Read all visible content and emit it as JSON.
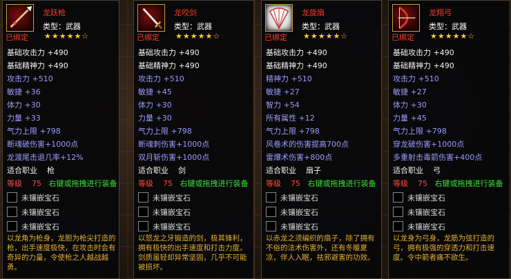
{
  "tooltips": [
    {
      "name": "龙跃枪",
      "type_label": "类型：武器",
      "bound": "已绑定",
      "stars": "★★★★★☆",
      "stats": [
        {
          "text": "基础攻击力 +490",
          "color": "white"
        },
        {
          "text": "基础精神力 +490",
          "color": "white"
        },
        {
          "text": "攻击力 +510",
          "color": "blue"
        },
        {
          "text": "敏捷 +36",
          "color": "blue"
        },
        {
          "text": "体力 +30",
          "color": "blue"
        },
        {
          "text": "力量 +33",
          "color": "blue"
        },
        {
          "text": "气力上限 +798",
          "color": "blue"
        },
        {
          "text": "断魂破伤害+1000点",
          "color": "blue"
        },
        {
          "text": "龙渡尾击退几率+12%",
          "color": "blue"
        }
      ],
      "job_label": "适合职业",
      "job_value": "枪",
      "level_label": "等级",
      "level_value": "75",
      "hint": "右键或拖拽进行装备",
      "sockets": [
        "未镶嵌宝石",
        "未镶嵌宝石",
        "未镶嵌宝石"
      ],
      "description": "以龙角为枪身，龙胆为枪尖打造的枪，出手速度极快，在攻击时会有奇异的力量，令使枪之人越战越勇。"
    },
    {
      "name": "龙咬剑",
      "type_label": "类型：武器",
      "bound": "已绑定",
      "stars": "★★★★★☆",
      "stats": [
        {
          "text": "基础攻击力 +490",
          "color": "white"
        },
        {
          "text": "基础精神力 +490",
          "color": "white"
        },
        {
          "text": "攻击力 +510",
          "color": "blue"
        },
        {
          "text": "敏捷 +45",
          "color": "blue"
        },
        {
          "text": "体力 +30",
          "color": "blue"
        },
        {
          "text": "力量 +30",
          "color": "blue"
        },
        {
          "text": "气力上限 +798",
          "color": "blue"
        },
        {
          "text": "断魂刺伤害+1000点",
          "color": "blue"
        },
        {
          "text": "双月斩伤害+1000点",
          "color": "blue"
        }
      ],
      "job_label": "适合职业",
      "job_value": "剑",
      "level_label": "等级",
      "level_value": "75",
      "hint": "右键或拖拽进行装备",
      "sockets": [
        "未镶嵌宝石",
        "未镶嵌宝石",
        "未镶嵌宝石"
      ],
      "description": "以怒龙之牙锻造的剑，极其锋利，拥有极快的出手速度和打击力度。剑质虽轻却异常坚固，几乎不可能被损坏。"
    },
    {
      "name": "龙旋扇",
      "type_label": "类型：武器",
      "bound": "已绑定",
      "stars": "★★★★★☆",
      "stats": [
        {
          "text": "基础攻击力 +490",
          "color": "white"
        },
        {
          "text": "基础精神力 +490",
          "color": "white"
        },
        {
          "text": "精神力 +510",
          "color": "blue"
        },
        {
          "text": "敏捷 +27",
          "color": "blue"
        },
        {
          "text": "智力 +54",
          "color": "blue"
        },
        {
          "text": "所有属性 +12",
          "color": "blue"
        },
        {
          "text": "气力上限 +798",
          "color": "blue"
        },
        {
          "text": "风卷术的伤害提高700点",
          "color": "blue"
        },
        {
          "text": "雷爆术伤害+800点",
          "color": "blue"
        }
      ],
      "job_label": "适合职业",
      "job_value": "扇子",
      "level_label": "等级",
      "level_value": "75",
      "hint": "右键或拖拽进行装备",
      "sockets": [
        "未镶嵌宝石",
        "未镶嵌宝石",
        "未镶嵌宝石"
      ],
      "description": "以赤龙之须编织的扇子，除了拥有不俗的法术伤害外，还有冬暖夏凉，伴人入眠，祛邪避害的功效。"
    },
    {
      "name": "龙翔弓",
      "type_label": "类型：武器",
      "bound": "已绑定",
      "stars": "★★★★★☆",
      "stats": [
        {
          "text": "基础攻击力 +490",
          "color": "white"
        },
        {
          "text": "基础精神力 +490",
          "color": "white"
        },
        {
          "text": "攻击力 +510",
          "color": "blue"
        },
        {
          "text": "敏捷 +27",
          "color": "blue"
        },
        {
          "text": "体力 +30",
          "color": "blue"
        },
        {
          "text": "力量 +45",
          "color": "blue"
        },
        {
          "text": "气力上限 +798",
          "color": "blue"
        },
        {
          "text": "穿龙破伤害+1000点",
          "color": "blue"
        },
        {
          "text": "多重射击毒箭伤害+400点",
          "color": "blue"
        }
      ],
      "job_label": "适合职业",
      "job_value": "弓",
      "level_label": "等级",
      "level_value": "75",
      "hint": "右键或拖拽进行装备",
      "sockets": [
        "未镶嵌宝石",
        "未镶嵌宝石",
        "未镶嵌宝石"
      ],
      "description": "以龙身为弓身，龙筋为弦打造的弓，拥有极强的穿透力和打击速度。令中箭者痛不欲生。"
    }
  ],
  "colors": {
    "name": "#ff3a2a",
    "stat_white": "#f4f4f4",
    "stat_blue": "#9a9cff",
    "level": "#ff4a3a",
    "hint": "#38e038",
    "description": "#e0b032",
    "stars": "#ffcc2a"
  },
  "icons": [
    "spear-icon",
    "sword-icon",
    "fan-icon",
    "bow-icon"
  ]
}
